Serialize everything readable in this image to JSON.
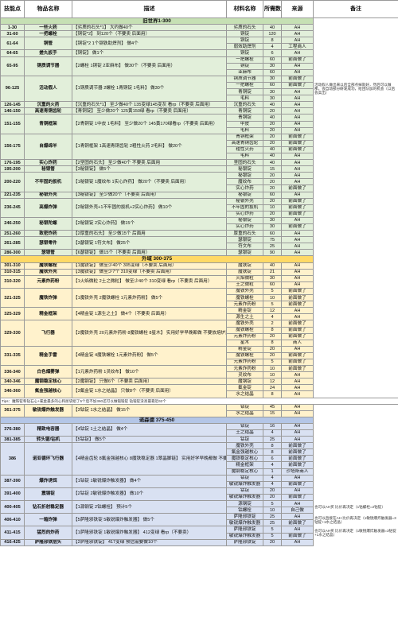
{
  "headers": [
    "技能点",
    "物品名称",
    "描述",
    "材料名称",
    "所需数量",
    "来源",
    "备注"
  ],
  "tips": "Tips：魔铁锭和钻石心+氟金最多的心和屌袋组了5个后不加360还可以做锻锻锭 钻锻锭没高最靠近62个",
  "sections": [
    {
      "title": "旧世界1-300",
      "style": "g1",
      "items": [
        {
          "lv": "1-30",
          "name": "一些火药",
          "desc": "【劣质的石头*1】 大约做40个",
          "mats": [
            [
              "劣质的石头",
              "40",
              "AH"
            ]
          ]
        },
        {
          "lv": "31-60",
          "name": "一把螺栓",
          "desc": "【铜锭*2】 到120个（不要卖 后面用）",
          "mats": [
            [
              "铜锭",
              "120",
              "AH"
            ]
          ]
        },
        {
          "lv": "61-64",
          "name": "铜管",
          "desc": "【铜锭*2 1个钢铁助焊剂】 做4个",
          "mats": [
            [
              "铜锭",
              "8",
              "AH"
            ],
            [
              "弱效助焊剂",
              "4",
              "工程商人"
            ]
          ]
        },
        {
          "lv": "64-65",
          "name": "搓丸扳手",
          "desc": "【铜锭】 做1个",
          "mats": [
            [
              "铜锭",
              "6",
              "AH"
            ]
          ]
        },
        {
          "lv": "65-95",
          "name": "铜质调节器",
          "desc": "【2螺栓 1铜锭 2亚麻布】 做30个（不要卖 后面用）",
          "mats": [
            [
              "一把螺栓",
              "60",
              "前面做了"
            ],
            [
              "铜锭",
              "30",
              "AH"
            ],
            [
              "亚麻布",
              "60",
              "AH"
            ]
          ]
        },
        {
          "lv": "96-125",
          "name": "活动假人",
          "desc": "【1铜质调节器 2螺栓 1青铜锭 1毛料】 做30个",
          "mats": [
            [
              "铜质调节器",
              "30",
              "前面做了"
            ],
            [
              "一把螺栓",
              "60",
              "前面做了"
            ],
            [
              "青铜锭",
              "30",
              "AH"
            ],
            [
              "毛料",
              "30",
              "AH"
            ]
          ],
          "note": "活动假人做出来以后全部点掉就好，然后可以做那，会自动部分研发成功，给团队加的机会（以后会卖出）"
        },
        {
          "lv": "126-145",
          "name": "沉重的火药",
          "desc": "【沉重的石头*1】 至少做40个 135变绿145变灰 看rp（不要卖 后面用）",
          "mats": [
            [
              "沉重的石头",
              "40",
              "AH"
            ]
          ]
        },
        {
          "lv": "146-150",
          "name": "高速青铜齿轮",
          "desc": "【青铜锭】 至少做20个 125黄150绿 看rp（不要卖 后面用）",
          "mats": [
            [
              "青铜锭",
              "20",
              "AH"
            ]
          ]
        },
        {
          "lv": "151-155",
          "name": "青铜框架",
          "desc": "【2青铜锭 1中皮 1毛料】 至少做20个 145黄170绿看rp（不要卖 后面用）",
          "mats": [
            [
              "青铜锭",
              "40",
              "AH"
            ],
            [
              "中皮",
              "20",
              "AH"
            ],
            [
              "毛料",
              "20",
              "AH"
            ]
          ]
        },
        {
          "lv": "156-175",
          "name": "自爆绵羊",
          "desc": "【1青铜框架 1高速青铜齿轮 2粗性火药 2毛料】 做20个",
          "mats": [
            [
              "青铜框架",
              "20",
              "前面做了"
            ],
            [
              "高速青铜齿轮",
              "20",
              "前面做了"
            ],
            [
              "粗性火药",
              "40",
              "前面做了"
            ],
            [
              "毛料",
              "40",
              "AH"
            ]
          ]
        },
        {
          "lv": "176-195",
          "name": "实心炸药",
          "desc": "【2坚固的石头】 至少做40个 不要卖 后面用",
          "mats": [
            [
              "坚固的石头",
              "40",
              "AH"
            ]
          ]
        },
        {
          "lv": "195-200",
          "name": "秘银管",
          "desc": "【3秘银锭】 做5个",
          "mats": [
            [
              "秘银锭",
              "15",
              "AH"
            ]
          ]
        },
        {
          "lv": "200-220",
          "name": "不牢固的扳机",
          "desc": "【1秘银锭 1魔纹布 1实心炸药】 做20个（不要卖 后面用）",
          "mats": [
            [
              "秘银锭",
              "20",
              "AH"
            ],
            [
              "魔纹布",
              "20",
              "AH"
            ],
            [
              "实心炸药",
              "20",
              "前面做了"
            ]
          ]
        },
        {
          "lv": "221-235",
          "name": "秘银外壳",
          "desc": "【3秘银锭】 至少做20个（不要卖 后面用）",
          "mats": [
            [
              "秘银锭",
              "60",
              "AH"
            ]
          ]
        },
        {
          "lv": "236-245",
          "name": "高爆炸弹",
          "desc": "【2秘银外壳+1不牢固的扳机+2实心炸药】 做10个",
          "mats": [
            [
              "秘银外壳",
              "20",
              "前面做了"
            ],
            [
              "不牢固的扳机",
              "10",
              "前面做了"
            ],
            [
              "实心炸药",
              "20",
              "前面做了"
            ]
          ]
        },
        {
          "lv": "246-250",
          "name": "秘银陀螺",
          "desc": "【2秘银锭 2实心炸药】 做15个",
          "mats": [
            [
              "秘银锭",
              "30",
              "AH"
            ],
            [
              "实心炸药",
              "30",
              "前面做了"
            ]
          ]
        },
        {
          "lv": "251-260",
          "name": "致密炸药",
          "desc": "【2厚重的石头】 至少做15个 后面用",
          "mats": [
            [
              "厚重的石头",
              "60",
              "AH"
            ]
          ]
        },
        {
          "lv": "261-285",
          "name": "瑟银零件",
          "desc": "【3瑟银锭 1符文布】 做25个",
          "mats": [
            [
              "瑟银锭",
              "75",
              "AH"
            ],
            [
              "符文布",
              "25",
              "AH"
            ]
          ]
        },
        {
          "lv": "286-300",
          "name": "瑟银管",
          "desc": "【6瑟银锭】 做15个（不要卖 后面用）",
          "mats": [
            [
              "瑟银锭",
              "90",
              "AH"
            ]
          ]
        }
      ]
    },
    {
      "title": "外域 300-375",
      "style": "g2",
      "items": [
        {
          "lv": "301-310",
          "name": "魔铁螺栓",
          "desc": "【1魔铁锭】 做至少40个 305变绿（不要卖 后面用）",
          "mats": [
            [
              "魔铁锭",
              "40",
              "AH"
            ]
          ]
        },
        {
          "lv": "310-315",
          "name": "魔铁外壳",
          "desc": "【3魔铁锭】 做至少7个 310变绿（不要卖 后面用）",
          "mats": [
            [
              "魔铁锭",
              "21",
              "AH"
            ]
          ]
        },
        {
          "lv": "310-320",
          "name": "元素炸药粉",
          "desc": "【1火焰微粒 2土之微粒】 做至少40个 310变绿 看rp（不要卖 后面用）",
          "mats": [
            [
              "火焰微粒",
              "30",
              "AH"
            ],
            [
              "土之微粒",
              "60",
              "AH"
            ]
          ]
        },
        {
          "lv": "321-325",
          "name": "魔铁炸弹",
          "desc": "【1魔铁外壳 2魔铁螺栓 1元素炸药粉】 做5个",
          "mats": [
            [
              "魔铁外壳",
              "5",
              "前面做了"
            ],
            [
              "魔铁螺栓",
              "10",
              "前面做了"
            ],
            [
              "元素炸药粉",
              "5",
              "前面做了"
            ]
          ]
        },
        {
          "lv": "325-329",
          "name": "精金框架",
          "desc": "【4精金锭 1源生之土】 做4个（不要卖 后面用）",
          "mats": [
            [
              "精金锭",
              "12",
              "AH"
            ],
            [
              "源生之土",
              "4",
              "AH"
            ]
          ]
        },
        {
          "lv": "329-330",
          "name": "飞行器",
          "desc": "【2魔铁外壳 20元素炸药粉 8魔铁螺栓 8星木】 实用好学早晚都做 不要放熔炉还存的",
          "mats": [
            [
              "魔铁外壳",
              "2",
              "前面做了"
            ],
            [
              "魔铁螺栓",
              "8",
              "前面做了"
            ],
            [
              "元素炸药粉",
              "20",
              "前面做了"
            ],
            [
              "星木",
              "8",
              "商人"
            ]
          ]
        },
        {
          "lv": "331-335",
          "name": "精金手雷",
          "desc": "【4精金锭 4魔铁螺栓 1元素炸药粉】 做5个",
          "mats": [
            [
              "精金锭",
              "20",
              "AH"
            ],
            [
              "魔铁螺栓",
              "20",
              "前面做了"
            ],
            [
              "元素炸药粉",
              "5",
              "前面做了"
            ]
          ]
        },
        {
          "lv": "336-340",
          "name": "白色烟雾弹",
          "desc": "【1元素炸药粉 1灵纹布】 做10个",
          "mats": [
            [
              "元素炸药粉",
              "10",
              "前面做了"
            ],
            [
              "灵纹布",
              "10",
              "AH"
            ]
          ]
        },
        {
          "lv": "340-346",
          "name": "魔钢稳定核心",
          "desc": "【2魔钢锭】 只做6个（不要卖 后面用）",
          "mats": [
            [
              "魔钢锭",
              "12",
              "AH"
            ]
          ]
        },
        {
          "lv": "346-360",
          "name": "氟金强越核心",
          "desc": "【3氟金锭 1水之结晶】 只做8个（不要卖 后面用）",
          "mats": [
            [
              "氟金锭",
              "24",
              "AH"
            ],
            [
              "水之结晶",
              "8",
              "AH"
            ]
          ]
        },
        {
          "lv": "361-375",
          "name": "敏锐爆炸触发器",
          "desc": "【3钴锭 1水之结晶】 做15个",
          "mats": [
            [
              "钴锭",
              "45",
              "AH"
            ],
            [
              "水之结晶",
              "15",
              "AH"
            ]
          ],
          "tips_before": true
        }
      ]
    },
    {
      "title": "诺森德 375-450",
      "style": "g3",
      "items": [
        {
          "lv": "376-380",
          "name": "精致电容器",
          "desc": "【4钴锭 1土之结晶】 做4个",
          "mats": [
            [
              "钴锭",
              "16",
              "AH"
            ],
            [
              "土之结晶",
              "4",
              "AH"
            ]
          ]
        },
        {
          "lv": "381-385",
          "name": "转头锯/钻机",
          "desc": "【5钴锭】 做5个",
          "mats": [
            [
              "钴锭",
              "25",
              "AH"
            ]
          ]
        },
        {
          "lv": "386",
          "name": "诺亚德环飞行器",
          "desc": "【4精金齿轮 8氟金强越核心 8魔铁稳定器 1翠晶脚链】 实用好学早晚都做 不要放熔炉还存的",
          "mats": [
            [
              "魔铁外壳",
              "8",
              "前面做了"
            ],
            [
              "氟金强越核心",
              "8",
              "前面做了"
            ],
            [
              "魔铁稳定核心",
              "6",
              "前面做了"
            ],
            [
              "精金框架",
              "4",
              "前面做了"
            ],
            [
              "魔钢稳定核心",
              "1",
              "沙塔斯商人"
            ]
          ]
        },
        {
          "lv": "387-390",
          "name": "爆炸诱饵",
          "desc": "【1钴锭 1敏锐爆炸触发器】 做4个",
          "mats": [
            [
              "钴锭",
              "4",
              "AH"
            ],
            [
              "敏锐爆炸触发器",
              "4",
              "前面做了"
            ]
          ]
        },
        {
          "lv": "391-400",
          "name": "震钢锭",
          "desc": "【2钴锭 2敏锐爆炸触发器】 做10个",
          "mats": [
            [
              "钴锭",
              "20",
              "AH"
            ],
            [
              "敏锐爆炸触发器",
              "20",
              "前面做了"
            ]
          ]
        },
        {
          "lv": "400-405",
          "name": "钻石折射稳定器",
          "desc": "【1源钢锭 2钴螺栓】 预计5个",
          "mats": [
            [
              "源钢锭",
              "5",
              "AH"
            ],
            [
              "钴螺栓",
              "10",
              "自己做"
            ]
          ],
          "note": "也可以AH买 比价再决定（1钴螺栓=2钴锭）"
        },
        {
          "lv": "406-410",
          "name": "一箱炸弹",
          "desc": "【5萨隆邪铁锭 5敏锐爆炸触发器】 做5个",
          "mats": [
            [
              "萨隆邪铁锭",
              "25",
              "AH"
            ],
            [
              "敏锐爆炸触发器",
              "25",
              "前面做了"
            ]
          ],
          "note": "也可以直接在AH 比价再决定（1敏锐爆炸触发器=3钴锭+1水之结晶）"
        },
        {
          "lv": "411-415",
          "name": "猛烈的炸药",
          "desc": "【1萨隆邪铁锭 1敏锐爆炸触发器】 412变绿 看rp（不要卖）",
          "mats": [
            [
              "萨隆邪铁锭",
              "5",
              "AH"
            ],
            [
              "敏锐爆炸触发器",
              "5",
              "前面做了"
            ]
          ],
          "note": "也可以AH买 比价再决定（1敏锐爆炸触发器=3钴锭+1水之结晶）"
        },
        {
          "lv": "416-425",
          "name": "萨隆邪铁层头",
          "desc": "【2萨隆邪铁锭】 417变绿 预估需要做10个",
          "mats": [
            [
              "萨隆邪铁锭",
              "20",
              "AH"
            ]
          ]
        }
      ]
    }
  ]
}
